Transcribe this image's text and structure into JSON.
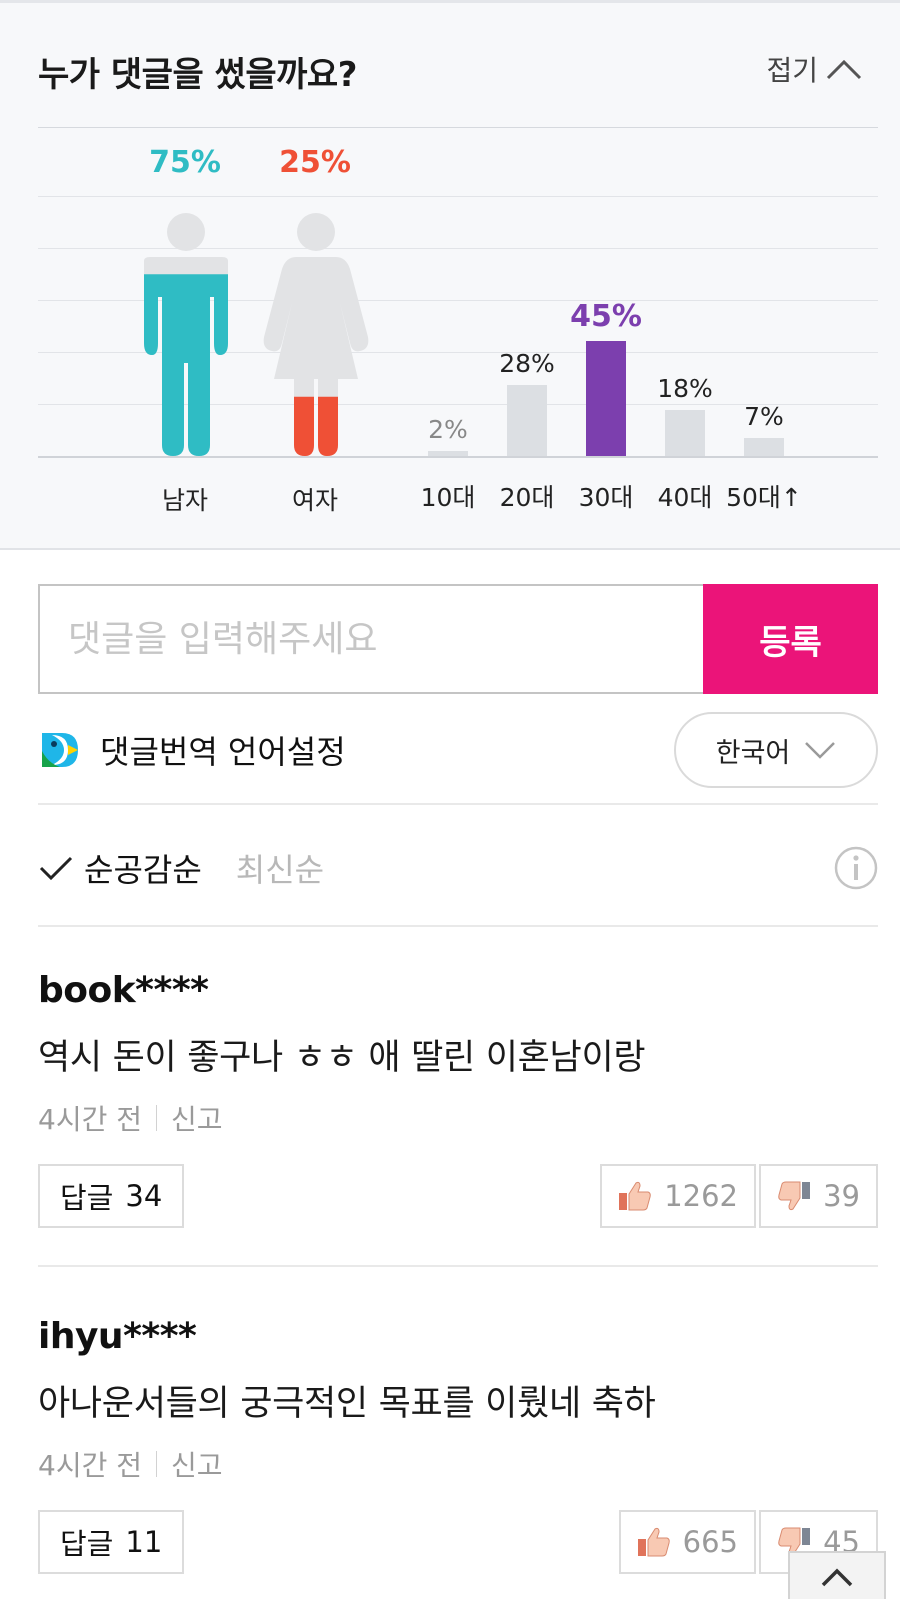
{
  "stats": {
    "title": "누가 댓글을 썼을까요?",
    "collapse_label": "접기",
    "gender": [
      {
        "label": "남자",
        "percent_text": "75%",
        "percent": 75,
        "color": "#2fbcc4"
      },
      {
        "label": "여자",
        "percent_text": "25%",
        "percent": 25,
        "color": "#ef5036"
      }
    ],
    "age": [
      {
        "label": "10대",
        "percent_text": "2%",
        "percent": 2,
        "highlight": false
      },
      {
        "label": "20대",
        "percent_text": "28%",
        "percent": 28,
        "highlight": false
      },
      {
        "label": "30대",
        "percent_text": "45%",
        "percent": 45,
        "highlight": true
      },
      {
        "label": "40대",
        "percent_text": "18%",
        "percent": 18,
        "highlight": false
      },
      {
        "label": "50대↑",
        "percent_text": "7%",
        "percent": 7,
        "highlight": false
      }
    ],
    "highlight_color": "#7c3fae",
    "bar_color": "#dcdfe3"
  },
  "comment_form": {
    "placeholder": "댓글을 입력해주세요",
    "submit_label": "등록",
    "submit_color": "#eb1479"
  },
  "translate": {
    "label": "댓글번역 언어설정",
    "language": "한국어"
  },
  "sort": {
    "active": "순공감순",
    "inactive": "최신순"
  },
  "comments": [
    {
      "author": "book****",
      "content": "역시 돈이 좋구나 ㅎㅎ 애 딸린 이혼남이랑",
      "time": "4시간 전",
      "report": "신고",
      "reply_label": "답글",
      "reply_count": "34",
      "likes": "1262",
      "dislikes": "39"
    },
    {
      "author": "ihyu****",
      "content": "아나운서들의 궁극적인 목표를 이뤘네 축하",
      "time": "4시간 전",
      "report": "신고",
      "reply_label": "답글",
      "reply_count": "11",
      "likes": "665",
      "dislikes": "45"
    }
  ]
}
